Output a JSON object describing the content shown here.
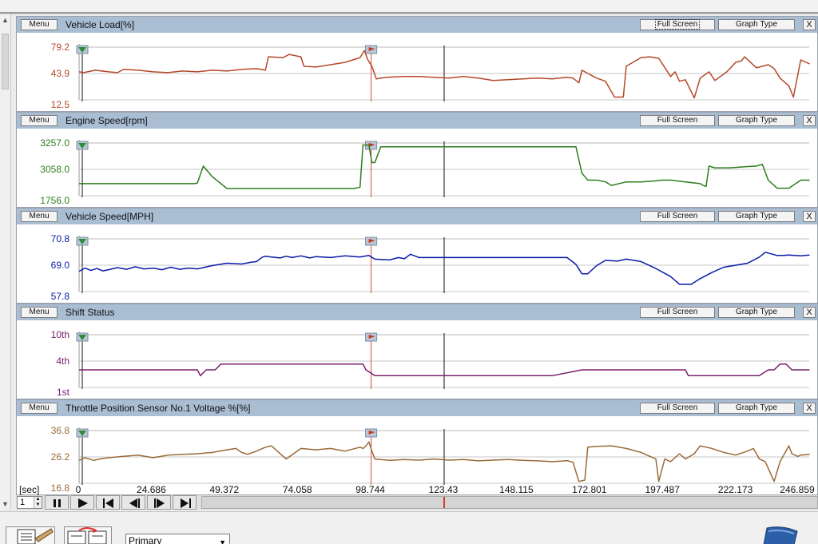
{
  "panel_controls": {
    "menu_label": "Menu",
    "full_screen_label": "Full Screen",
    "graph_type_label": "Graph Type",
    "close_label": "X"
  },
  "time_axis": {
    "unit": "[sec]",
    "ticks": [
      "0",
      "24.686",
      "49.372",
      "74.058",
      "98.744",
      "123.43",
      "148.115",
      "172.801",
      "197.487",
      "222.173",
      "246.859"
    ]
  },
  "playback": {
    "page_value": "1",
    "cursor_time": 123.43
  },
  "bottom": {
    "select_value": "Primary"
  },
  "colors": {
    "vehicle_load": "#b5482a",
    "engine_speed": "#2e7d1e",
    "vehicle_speed": "#0a1aa8",
    "shift_status": "#7a1f6e",
    "throttle": "#9a6a38",
    "header": "#a9bdd3",
    "marker_line": "#d34a3a"
  },
  "chart_data": [
    {
      "type": "line",
      "title": "Vehicle Load[%]",
      "ylabels": [
        "79.2",
        "43.9",
        "12.5"
      ],
      "ylim": [
        12.5,
        79.2
      ],
      "x": [
        0,
        1.5,
        5.5,
        10,
        13,
        15,
        20,
        25,
        30,
        35,
        40,
        45,
        50,
        55,
        60,
        63,
        64,
        69,
        71,
        75,
        76,
        80,
        85,
        90,
        95,
        96.5,
        97.5,
        99,
        100.5,
        102,
        104,
        110,
        115,
        120,
        125,
        130,
        135,
        140,
        145,
        150,
        155,
        160,
        165,
        167,
        169,
        170,
        172,
        174,
        175,
        178,
        181,
        184,
        185,
        190,
        193,
        196,
        200,
        201.5,
        203,
        205,
        208,
        210,
        213,
        215,
        219,
        222,
        224,
        225,
        229,
        233,
        235,
        237,
        240,
        241.5,
        244,
        247
      ],
      "series": [
        {
          "values": [
            48,
            47,
            50,
            48,
            47,
            51,
            50,
            48,
            47,
            49,
            48,
            50,
            49,
            51,
            52,
            50,
            67,
            66,
            70,
            67,
            55,
            54,
            57,
            60,
            66,
            75,
            64,
            55,
            39,
            40,
            41,
            42,
            42,
            41,
            40,
            42,
            40,
            37,
            38,
            39,
            40,
            39,
            41,
            40,
            34,
            50,
            46,
            42,
            40,
            36,
            16,
            16,
            55,
            66,
            67,
            65,
            42,
            48,
            36,
            38,
            15,
            40,
            48,
            37,
            48,
            60,
            62,
            67,
            53,
            57,
            52,
            40,
            30,
            16,
            63,
            58
          ]
        }
      ]
    },
    {
      "type": "line",
      "title": "Engine Speed[rpm]",
      "ylabels": [
        "3257.0",
        "3058.0",
        "1756.0"
      ],
      "ylim": [
        1756,
        3257
      ],
      "x": [
        0,
        30,
        35,
        38,
        39,
        40,
        42,
        45,
        50,
        55,
        60,
        65,
        70,
        75,
        80,
        85,
        90,
        93,
        94,
        95,
        96,
        98,
        99,
        100,
        102,
        110,
        120,
        130,
        140,
        145,
        150,
        155,
        160,
        163,
        168,
        170,
        172,
        174,
        175,
        178,
        180,
        185,
        190,
        195,
        197,
        200,
        205,
        210,
        211,
        212,
        213,
        215,
        220,
        225,
        229,
        231,
        233,
        236,
        240,
        244,
        247
      ],
      "series": [
        {
          "values": [
            2100,
            2100,
            2100,
            2100,
            2100,
            2120,
            2600,
            2300,
            1960,
            1960,
            1960,
            1960,
            1960,
            1960,
            1960,
            1960,
            1960,
            1960,
            1980,
            2000,
            3200,
            3200,
            2700,
            2700,
            3150,
            3150,
            3150,
            3150,
            3150,
            3150,
            3150,
            3150,
            3150,
            3150,
            3150,
            2400,
            2200,
            2200,
            2200,
            2150,
            2050,
            2150,
            2150,
            2180,
            2200,
            2200,
            2150,
            2100,
            2050,
            2020,
            2600,
            2550,
            2550,
            2580,
            2600,
            2650,
            2200,
            1970,
            1970,
            2200,
            2200
          ]
        }
      ]
    },
    {
      "type": "line",
      "title": "Vehicle Speed[MPH]",
      "ylabels": [
        "70.8",
        "69.0",
        "57.8"
      ],
      "ylim": [
        57.8,
        70.8
      ],
      "x": [
        0,
        2,
        4,
        6,
        8,
        10,
        13,
        16,
        19,
        22,
        25,
        28,
        31,
        34,
        37,
        40,
        45,
        50,
        55,
        58,
        60,
        62,
        63,
        65,
        68,
        70,
        72,
        75,
        78,
        80,
        85,
        90,
        95,
        98,
        100,
        105,
        108,
        110,
        112,
        115,
        117,
        120,
        130,
        140,
        150,
        160,
        165,
        168,
        170,
        172,
        175,
        178,
        182,
        185,
        190,
        195,
        200,
        203,
        207,
        210,
        214,
        218,
        222,
        226,
        230,
        232,
        234,
        236,
        238,
        240,
        244,
        247
      ],
      "series": [
        {
          "values": [
            62.8,
            63.6,
            63.0,
            63.5,
            62.9,
            63.2,
            63.7,
            63.3,
            63.9,
            63.4,
            63.6,
            63.2,
            63.8,
            63.3,
            63.6,
            63.4,
            64.2,
            64.8,
            64.6,
            65.0,
            65.2,
            66.3,
            66.5,
            66.3,
            66.1,
            66.5,
            66.2,
            66.6,
            66.1,
            66.4,
            66.2,
            66.6,
            66.3,
            66.7,
            65.8,
            65.6,
            66.2,
            65.9,
            67.0,
            66.2,
            66.2,
            66.2,
            66.2,
            66.2,
            66.2,
            66.2,
            66.2,
            64.5,
            62.2,
            62.2,
            64.2,
            65.5,
            65.3,
            65.8,
            65.2,
            63.5,
            61.5,
            59.6,
            59.6,
            61.0,
            62.5,
            63.8,
            64.3,
            64.8,
            66.3,
            67.5,
            67.1,
            66.7,
            66.7,
            66.8,
            66.6,
            66.8
          ]
        }
      ]
    },
    {
      "type": "line",
      "title": "Shift Status",
      "ylabels": [
        "10th",
        "4th",
        "1st"
      ],
      "ylim": [
        1,
        10
      ],
      "x": [
        0,
        10,
        20,
        30,
        39,
        40,
        41,
        43,
        45,
        46,
        48,
        52,
        60,
        70,
        80,
        90,
        92,
        95,
        96,
        97,
        100,
        110,
        120,
        130,
        140,
        145,
        150,
        155,
        160,
        170,
        180,
        190,
        200,
        205,
        206,
        210,
        220,
        230,
        233,
        235,
        237,
        239,
        241,
        245,
        247
      ],
      "series": [
        {
          "values": [
            4,
            4,
            4,
            4,
            4,
            4,
            3,
            4,
            4,
            4,
            5,
            5,
            5,
            5,
            5,
            5,
            5,
            5,
            5,
            4,
            3,
            3,
            3,
            3,
            3,
            3,
            3,
            3,
            3,
            4,
            4,
            4,
            4,
            4,
            3,
            3,
            3,
            3,
            4,
            4,
            5,
            5,
            4,
            4,
            4
          ]
        }
      ]
    },
    {
      "type": "line",
      "title": "Throttle Position Sensor No.1 Voltage %[%]",
      "ylabels": [
        "36.8",
        "26.2",
        "16.8"
      ],
      "ylim": [
        16.8,
        36.8
      ],
      "x": [
        0,
        2,
        5,
        7,
        10,
        15,
        20,
        25,
        30,
        35,
        40,
        45,
        50,
        53,
        55,
        57,
        60,
        63,
        65,
        70,
        75,
        80,
        85,
        90,
        95,
        96,
        97,
        98,
        99,
        100,
        105,
        110,
        115,
        120,
        125,
        130,
        135,
        140,
        145,
        150,
        155,
        160,
        163,
        165,
        167,
        169,
        171,
        172,
        175,
        180,
        185,
        190,
        193,
        195,
        196,
        198,
        200,
        203,
        205,
        208,
        210,
        214,
        218,
        222,
        226,
        228,
        230,
        232,
        235,
        237,
        240,
        241,
        243,
        244,
        247
      ],
      "series": [
        {
          "values": [
            25.5,
            26.5,
            25.5,
            26.0,
            26.5,
            27.0,
            27.5,
            26.5,
            27.5,
            27.8,
            28.0,
            28.5,
            29.5,
            30.0,
            28.5,
            27.8,
            29.0,
            30.5,
            31.0,
            26.0,
            30.0,
            29.5,
            30.0,
            29.0,
            30.5,
            30.0,
            31.0,
            32.5,
            29.0,
            26.0,
            25.5,
            25.8,
            25.6,
            26.0,
            25.6,
            25.8,
            25.3,
            25.6,
            25.8,
            25.5,
            25.3,
            25.0,
            25.2,
            25.4,
            24.8,
            17.5,
            18.0,
            30.5,
            30.8,
            31.0,
            30.0,
            28.5,
            27.0,
            26.0,
            17.5,
            26.0,
            25.0,
            28.0,
            26.0,
            28.0,
            31.0,
            30.0,
            28.5,
            27.5,
            29.0,
            30.0,
            26.0,
            25.0,
            17.5,
            25.0,
            31.0,
            28.0,
            27.0,
            27.5,
            27.8
          ]
        }
      ]
    }
  ]
}
